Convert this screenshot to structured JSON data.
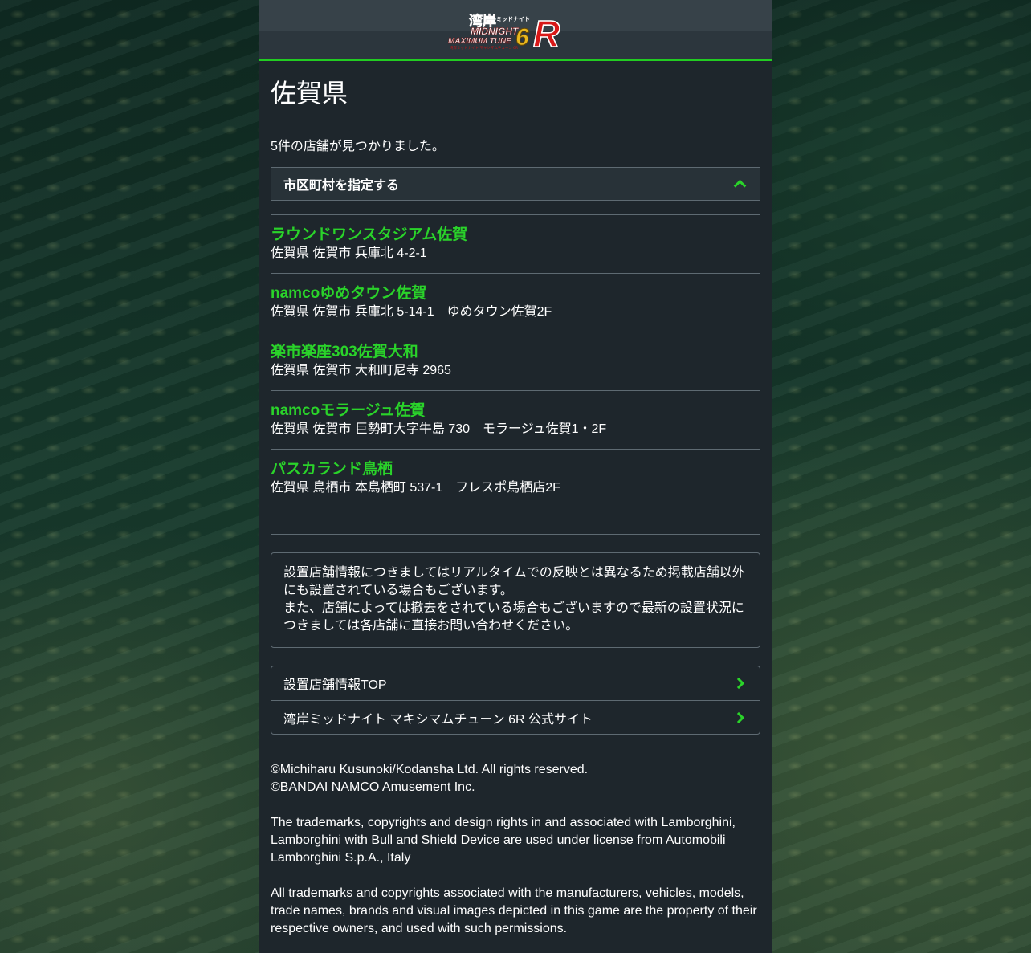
{
  "header": {
    "logo_alt": "湾岸ミッドナイト マキシマムチューン 6R"
  },
  "page": {
    "title": "佐賀県",
    "result_count": "5件の店舗が見つかりました。"
  },
  "city_filter": {
    "label": "市区町村を指定する",
    "icon": "chevron-up-icon"
  },
  "stores": [
    {
      "name": "ラウンドワンスタジアム佐賀",
      "address": "佐賀県 佐賀市 兵庫北 4-2-1"
    },
    {
      "name": "namcoゆめタウン佐賀",
      "address": "佐賀県 佐賀市 兵庫北 5-14-1　ゆめタウン佐賀2F"
    },
    {
      "name": "楽市楽座303佐賀大和",
      "address": "佐賀県 佐賀市 大和町尼寺 2965"
    },
    {
      "name": "namcoモラージュ佐賀",
      "address": "佐賀県 佐賀市 巨勢町大字牛島 730　モラージュ佐賀1・2F"
    },
    {
      "name": "パスカランド鳥栖",
      "address": "佐賀県 鳥栖市 本鳥栖町 537-1　フレスポ鳥栖店2F"
    }
  ],
  "notice": {
    "line1": "設置店舗情報につきましてはリアルタイムでの反映とは異なるため掲載店舗以外にも設置されている場合もございます。",
    "line2": "また、店舗によっては撤去をされている場合もございますので最新の設置状況につきましては各店舗に直接お問い合わせください。"
  },
  "links": [
    {
      "label": "設置店舗情報TOP",
      "icon": "chevron-right-icon"
    },
    {
      "label": "湾岸ミッドナイト マキシマムチューン 6R 公式サイト",
      "icon": "chevron-right-icon"
    }
  ],
  "footer": {
    "copyright1": "©Michiharu Kusunoki/Kodansha Ltd. All rights reserved.",
    "copyright2": "©BANDAI NAMCO Amusement Inc.",
    "trademark1": "The trademarks, copyrights and design rights in and associated with Lamborghini, Lamborghini with Bull and Shield Device are used under license from Automobili Lamborghini S.p.A., Italy",
    "trademark2": "All trademarks and copyrights associated with the manufacturers, vehicles, models, trade names, brands and visual images depicted in this game are the property of their respective owners, and used with such permissions."
  },
  "colors": {
    "accent_green": "#2ad32a",
    "panel_bg": "#1e262c",
    "border": "#5e6a72"
  }
}
